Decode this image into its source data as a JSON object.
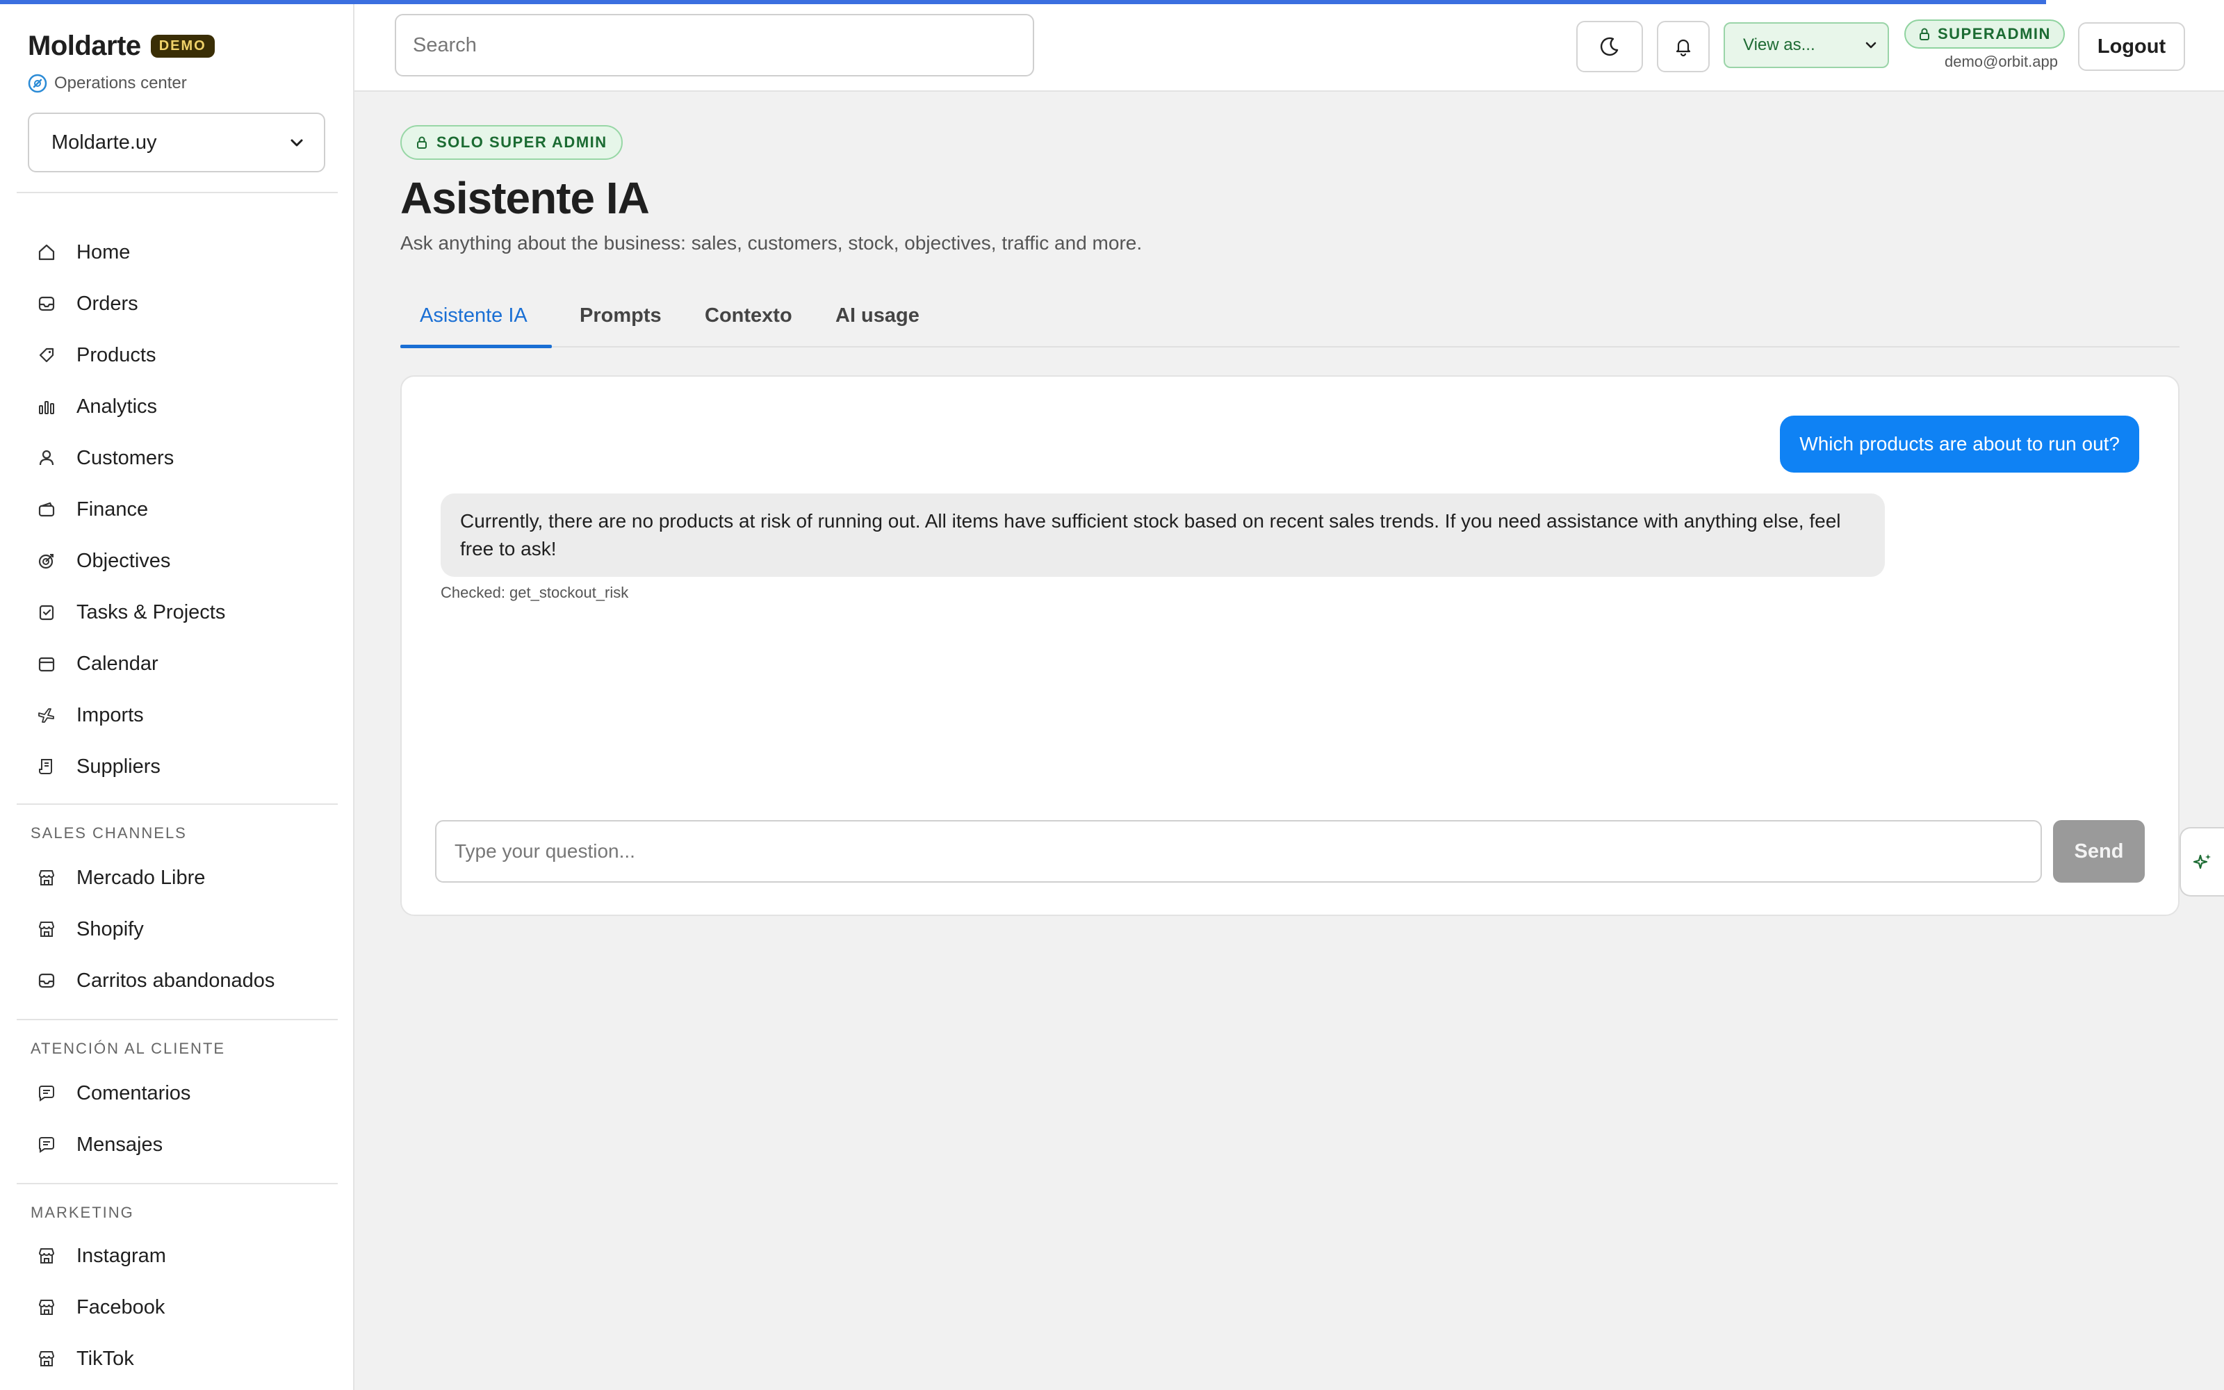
{
  "brand": {
    "name": "Moldarte",
    "demo_badge": "DEMO",
    "subtitle": "Operations center"
  },
  "store_select": {
    "value": "Moldarte.uy"
  },
  "sidebar": {
    "main_items": [
      {
        "label": "Home",
        "icon": "home-icon"
      },
      {
        "label": "Orders",
        "icon": "inbox-icon"
      },
      {
        "label": "Products",
        "icon": "tag-icon"
      },
      {
        "label": "Analytics",
        "icon": "bar-chart-icon"
      },
      {
        "label": "Customers",
        "icon": "user-icon"
      },
      {
        "label": "Finance",
        "icon": "wallet-icon"
      },
      {
        "label": "Objectives",
        "icon": "target-icon"
      },
      {
        "label": "Tasks & Projects",
        "icon": "clipboard-check-icon"
      },
      {
        "label": "Calendar",
        "icon": "calendar-icon"
      },
      {
        "label": "Imports",
        "icon": "plane-icon"
      },
      {
        "label": "Suppliers",
        "icon": "scroll-icon"
      }
    ],
    "sales_channels": {
      "title": "SALES CHANNELS",
      "items": [
        {
          "label": "Mercado Libre",
          "icon": "store-icon"
        },
        {
          "label": "Shopify",
          "icon": "store-icon"
        },
        {
          "label": "Carritos abandonados",
          "icon": "inbox-icon"
        }
      ]
    },
    "customer_care": {
      "title": "ATENCIÓN AL CLIENTE",
      "items": [
        {
          "label": "Comentarios",
          "icon": "message-icon"
        },
        {
          "label": "Mensajes",
          "icon": "message-icon"
        }
      ]
    },
    "marketing": {
      "title": "MARKETING",
      "items": [
        {
          "label": "Instagram",
          "icon": "store-icon"
        },
        {
          "label": "Facebook",
          "icon": "store-icon"
        },
        {
          "label": "TikTok",
          "icon": "store-icon"
        }
      ]
    }
  },
  "topbar": {
    "search_placeholder": "Search",
    "view_as": "View as...",
    "role_badge": "SUPERADMIN",
    "user_email": "demo@orbit.app",
    "logout_label": "Logout"
  },
  "main": {
    "badge": "SOLO SUPER ADMIN",
    "title": "Asistente IA",
    "subtitle": "Ask anything about the business: sales, customers, stock, objectives, traffic and more.",
    "tabs": [
      {
        "label": "Asistente IA",
        "active": true
      },
      {
        "label": "Prompts",
        "active": false
      },
      {
        "label": "Contexto",
        "active": false
      },
      {
        "label": "AI usage",
        "active": false
      }
    ]
  },
  "chat": {
    "user_message": "Which products are about to run out?",
    "assistant_message": "Currently, there are no products at risk of running out. All items have sufficient stock based on recent sales trends. If you need assistance with anything else, feel free to ask!",
    "tool_note": "Checked: get_stockout_risk",
    "input_placeholder": "Type your question...",
    "send_label": "Send"
  },
  "colors": {
    "accent": "#1a6fd4",
    "user_bubble": "#0f82f4",
    "success_green": "#1b6b32",
    "demo_badge_bg": "#3a2e06"
  }
}
